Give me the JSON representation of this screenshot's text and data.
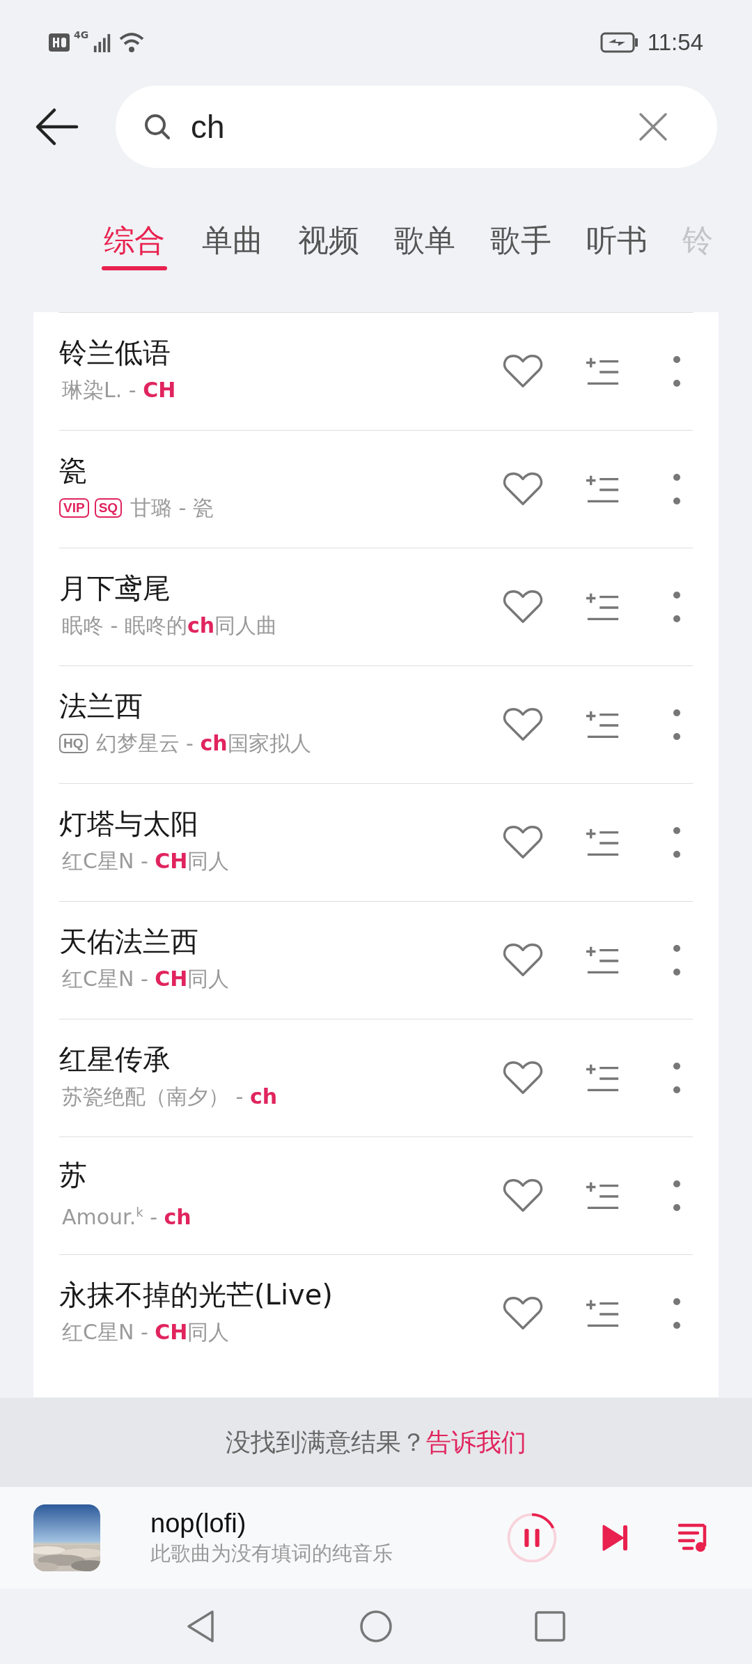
{
  "status_bar": {
    "time": "11:54",
    "network": "4G"
  },
  "search": {
    "value": "ch"
  },
  "tabs": [
    {
      "label": "综合",
      "selected": true
    },
    {
      "label": "单曲",
      "selected": false
    },
    {
      "label": "视频",
      "selected": false
    },
    {
      "label": "歌单",
      "selected": false
    },
    {
      "label": "歌手",
      "selected": false
    },
    {
      "label": "听书",
      "selected": false
    },
    {
      "label": "铃",
      "selected": false
    }
  ],
  "songs": [
    {
      "title": "铃兰低语",
      "subtitle": "琳染L. - **CH**"
    },
    {
      "title": "瓷",
      "badges": [
        {
          "label": "VIP",
          "color": "#e0245e"
        },
        {
          "label": "SQ",
          "color": "#e0245e"
        }
      ],
      "subtitle": "甘璐 - 瓷"
    },
    {
      "title": "月下鸢尾",
      "subtitle": "眠咚 - 眠咚的**ch**同人曲"
    },
    {
      "title": "法兰西",
      "badges": [
        {
          "label": "HQ",
          "color": "#8a8a8a"
        }
      ],
      "subtitle": "幻梦星云 - **ch**国家拟人"
    },
    {
      "title": "灯塔与太阳",
      "subtitle": "红C星N - **CH**同人"
    },
    {
      "title": "天佑法兰西",
      "subtitle": "红C星N - **CH**同人"
    },
    {
      "title": "红星传承",
      "subtitle": "苏瓷绝配（南夕） - **ch**"
    },
    {
      "title": "苏",
      "subtitle": "Amour.$^{k}$ - **ch**"
    },
    {
      "title": "永抹不掉的光芒(Live)",
      "subtitle": "红C星N - **CH**同人"
    }
  ],
  "feedback": {
    "text": "没找到满意结果？",
    "link": "告诉我们"
  },
  "player": {
    "title": "nop(lofi)",
    "subtitle": "此歌曲为没有填词的纯音乐",
    "playing": true
  }
}
